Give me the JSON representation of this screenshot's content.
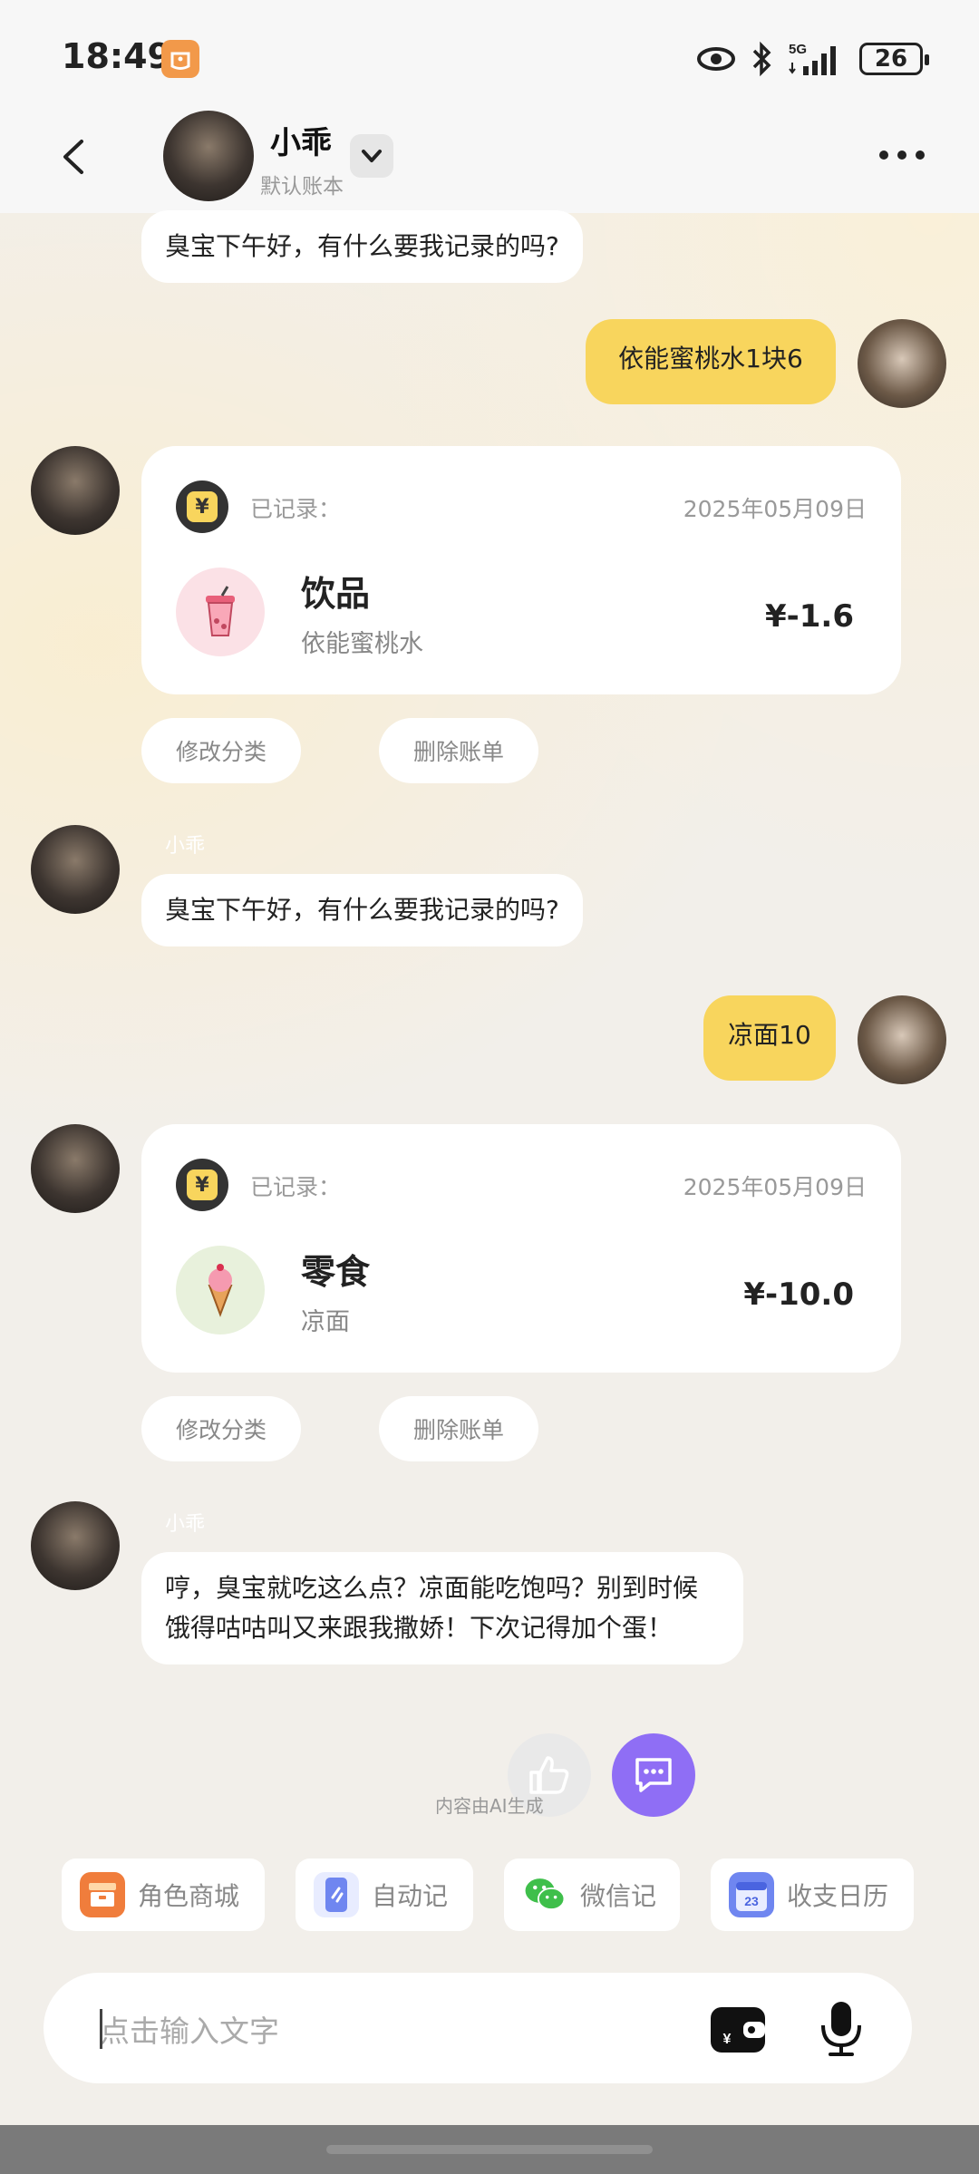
{
  "status_bar": {
    "time": "18:49",
    "battery": "26",
    "network": "5G"
  },
  "header": {
    "name": "小乖",
    "subtitle": "默认账本"
  },
  "messages": {
    "greeting_1": "臭宝下午好，有什么要我记录的吗?",
    "user_1": "依能蜜桃水1块6",
    "greeting_2": "臭宝下午好，有什么要我记录的吗?",
    "sender_2": "小乖",
    "user_2": "凉面10",
    "reply_3": "哼，臭宝就吃这么点？凉面能吃饱吗？别到时候饿得咕咕叫又来跟我撒娇！下次记得加个蛋！",
    "sender_3": "小乖"
  },
  "record_1": {
    "label": "已记录：",
    "date": "2025年05月09日",
    "category": "饮品",
    "note": "依能蜜桃水",
    "amount": "¥-1.6",
    "icon": "drink-cup-icon"
  },
  "record_2": {
    "label": "已记录：",
    "date": "2025年05月09日",
    "category": "零食",
    "note": "凉面",
    "amount": "¥-10.0",
    "icon": "ice-cream-icon"
  },
  "actions": {
    "edit_category": "修改分类",
    "delete_bill": "删除账单"
  },
  "ai_note": "内容由AI生成",
  "quick_actions": [
    {
      "label": "角色商城",
      "icon": "shop-box-icon"
    },
    {
      "label": "自动记",
      "icon": "phone-auto-icon"
    },
    {
      "label": "微信记",
      "icon": "wechat-icon"
    },
    {
      "label": "收支日历",
      "icon": "calendar-icon",
      "day": "23"
    }
  ],
  "input": {
    "placeholder": "点击输入文字"
  },
  "colors": {
    "accent_yellow": "#f8d55d",
    "feedback_purple": "#8f6ef5",
    "background": "#f2efea"
  }
}
